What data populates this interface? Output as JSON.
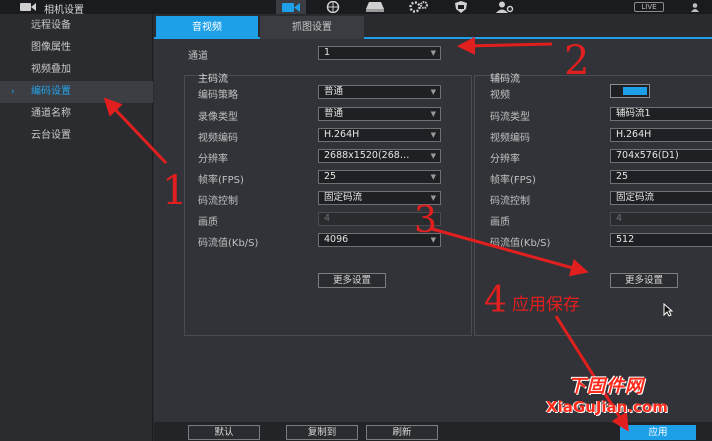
{
  "window": {
    "title": "相机设置",
    "live_badge": "LIVE"
  },
  "top_icons": [
    "camera-icon",
    "network-icon",
    "storage-icon",
    "gears-icon",
    "shield-icon",
    "users-icon",
    "person-icon"
  ],
  "sidebar": {
    "items": [
      {
        "label": "远程设备"
      },
      {
        "label": "图像属性"
      },
      {
        "label": "视频叠加"
      },
      {
        "label": "编码设置",
        "active": true
      },
      {
        "label": "通道名称"
      },
      {
        "label": "云台设置"
      }
    ]
  },
  "tabs": [
    {
      "label": "音视频",
      "active": true
    },
    {
      "label": "抓图设置"
    }
  ],
  "channel": {
    "label": "通道",
    "value": "1"
  },
  "main_stream": {
    "title": "主码流",
    "fields": [
      {
        "label": "编码策略",
        "value": "普通"
      },
      {
        "label": "录像类型",
        "value": "普通"
      },
      {
        "label": "视频编码",
        "value": "H.264H"
      },
      {
        "label": "分辨率",
        "value": "2688x1520(268…"
      },
      {
        "label": "帧率(FPS)",
        "value": "25"
      },
      {
        "label": "码流控制",
        "value": "固定码流"
      },
      {
        "label": "画质",
        "value": "4"
      },
      {
        "label": "码流值(Kb/S)",
        "value": "4096"
      }
    ],
    "more_button": "更多设置"
  },
  "sub_stream": {
    "title": "辅码流",
    "video_label": "视频",
    "video_enabled": true,
    "fields": [
      {
        "label": "码流类型",
        "value": "辅码流1"
      },
      {
        "label": "视频编码",
        "value": "H.264H"
      },
      {
        "label": "分辨率",
        "value": "704x576(D1)"
      },
      {
        "label": "帧率(FPS)",
        "value": "25"
      },
      {
        "label": "码流控制",
        "value": "固定码流"
      },
      {
        "label": "画质",
        "value": "4"
      },
      {
        "label": "码流值(Kb/S)",
        "value": "512"
      }
    ],
    "more_button": "更多设置"
  },
  "footer": {
    "default_button": "默认",
    "copy_button": "复制到",
    "refresh_button": "刷新",
    "apply_button": "应用"
  },
  "annotations": {
    "n1": "1",
    "n2": "2",
    "n3": "3",
    "n4": "4",
    "apply_save": "应用保存",
    "color": "#e21f1f"
  },
  "watermark": {
    "cn": "下固件网",
    "en": "XiaGuJian.com"
  }
}
